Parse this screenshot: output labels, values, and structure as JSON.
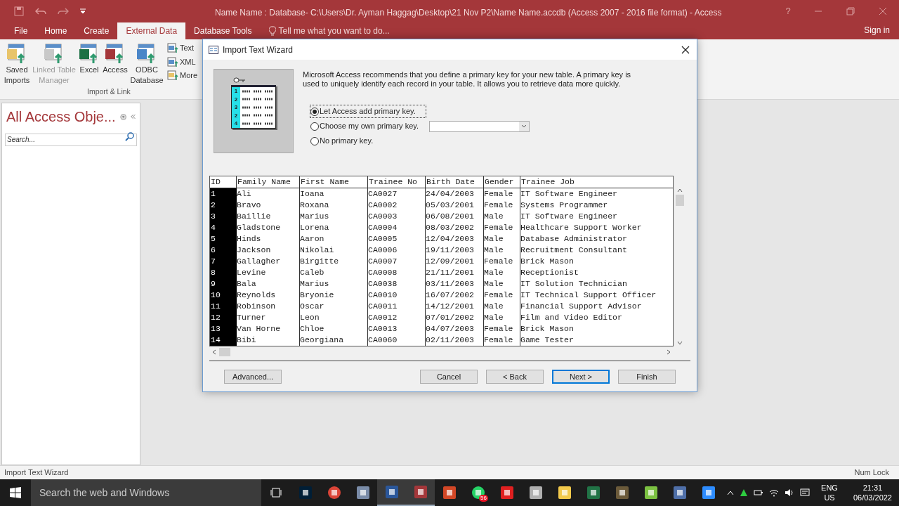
{
  "window": {
    "title": "Name Name : Database- C:\\Users\\Dr. Ayman Haggag\\Desktop\\21 Nov P2\\Name Name.accdb (Access 2007 - 2016 file format) - Access",
    "sign_in": "Sign in",
    "help": "?"
  },
  "ribbon_tabs": [
    {
      "label": "File",
      "selected": false
    },
    {
      "label": "Home",
      "selected": false
    },
    {
      "label": "Create",
      "selected": false
    },
    {
      "label": "External Data",
      "selected": true
    },
    {
      "label": "Database Tools",
      "selected": false
    }
  ],
  "tell_me": "Tell me what you want to do...",
  "ribbon": {
    "group_label": "Import & Link",
    "buttons": [
      {
        "kind": "saved",
        "label": "Saved Imports",
        "disabled": false
      },
      {
        "kind": "linked",
        "label": "Linked Table Manager",
        "disabled": true
      },
      {
        "kind": "excel",
        "label": "Excel",
        "disabled": false
      },
      {
        "kind": "access",
        "label": "Access",
        "disabled": false
      },
      {
        "kind": "odbc",
        "label": "ODBC Database",
        "disabled": false
      }
    ],
    "small_buttons": [
      {
        "kind": "text",
        "label": "Text"
      },
      {
        "kind": "xml",
        "label": "XML"
      },
      {
        "kind": "more",
        "label": "More"
      }
    ]
  },
  "nav_pane": {
    "title": "All Access Obje...",
    "search_placeholder": "Search..."
  },
  "dialog": {
    "title": "Import Text Wizard",
    "message": "Microsoft Access recommends that you define a primary key for your new table. A primary key is used to uniquely identify each record in your table. It allows you to retrieve data more quickly.",
    "illustration_rows": [
      "1",
      "2",
      "3",
      "2",
      "4"
    ],
    "options": [
      {
        "label": "Let Access add primary key.",
        "selected": true
      },
      {
        "label": "Choose my own primary key.",
        "selected": false
      },
      {
        "label": "No primary key.",
        "selected": false
      }
    ],
    "table": {
      "columns": [
        "ID",
        "Family Name",
        "First Name",
        "Trainee No",
        "Birth Date",
        "Gender",
        "Trainee Job"
      ],
      "rows": [
        [
          "1",
          "Ali",
          "Ioana",
          "CA0027",
          "24/04/2003",
          "Female",
          "IT Software Engineer"
        ],
        [
          "2",
          "Bravo",
          "Roxana",
          "CA0002",
          "05/03/2001",
          "Female",
          "Systems Programmer"
        ],
        [
          "3",
          "Baillie",
          "Marius",
          "CA0003",
          "06/08/2001",
          "Male",
          "IT Software Engineer"
        ],
        [
          "4",
          "Gladstone",
          "Lorena",
          "CA0004",
          "08/03/2002",
          "Female",
          "Healthcare Support Worker"
        ],
        [
          "5",
          "Hinds",
          "Aaron",
          "CA0005",
          "12/04/2003",
          "Male",
          "Database Administrator"
        ],
        [
          "6",
          "Jackson",
          "Nikolai",
          "CA0006",
          "19/11/2003",
          "Male",
          "Recruitment Consultant"
        ],
        [
          "7",
          "Gallagher",
          "Birgitte",
          "CA0007",
          "12/09/2001",
          "Female",
          "Brick Mason"
        ],
        [
          "8",
          "Levine",
          "Caleb",
          "CA0008",
          "21/11/2001",
          "Male",
          "Receptionist"
        ],
        [
          "9",
          "Bala",
          "Marius",
          "CA0038",
          "03/11/2003",
          "Male",
          "IT Solution Technician"
        ],
        [
          "10",
          "Reynolds",
          "Bryonie",
          "CA0010",
          "16/07/2002",
          "Female",
          "IT Technical Support Officer"
        ],
        [
          "11",
          "Robinson",
          "Oscar",
          "CA0011",
          "14/12/2001",
          "Male",
          "Financial Support Advisor"
        ],
        [
          "12",
          "Turner",
          "Leon",
          "CA0012",
          "07/01/2002",
          "Male",
          "Film and Video Editor"
        ],
        [
          "13",
          "Van Horne",
          "Chloe",
          "CA0013",
          "04/07/2003",
          "Female",
          "Brick Mason"
        ],
        [
          "14",
          "Bibi",
          "Georgiana",
          "CA0060",
          "02/11/2003",
          "Female",
          "Game Tester"
        ]
      ]
    },
    "buttons": [
      {
        "label": "Advanced...",
        "default": false
      },
      {
        "label": "Cancel",
        "default": false
      },
      {
        "label": "< Back",
        "default": false
      },
      {
        "label": "Next >",
        "default": true
      },
      {
        "label": "Finish",
        "default": false
      }
    ]
  },
  "status_bar": {
    "left": "Import Text Wizard",
    "right": "Num Lock"
  },
  "taskbar": {
    "search_placeholder": "Search the web and Windows",
    "apps": [
      {
        "kind": "ps",
        "active": false
      },
      {
        "kind": "chrome",
        "active": false
      },
      {
        "kind": "mail",
        "active": false
      },
      {
        "kind": "word",
        "active": true
      },
      {
        "kind": "access",
        "active": true
      },
      {
        "kind": "ppt",
        "active": false
      },
      {
        "kind": "chat",
        "active": false,
        "badge": "56"
      },
      {
        "kind": "pdf",
        "active": false
      },
      {
        "kind": "tool",
        "active": false
      },
      {
        "kind": "folder",
        "active": false
      },
      {
        "kind": "excel",
        "active": false
      },
      {
        "kind": "sq",
        "active": false
      },
      {
        "kind": "plant",
        "active": false
      },
      {
        "kind": "vb",
        "active": false
      },
      {
        "kind": "video",
        "active": false
      }
    ],
    "language": [
      "ENG",
      "US"
    ],
    "time": "21:31",
    "date": "06/03/2022"
  }
}
